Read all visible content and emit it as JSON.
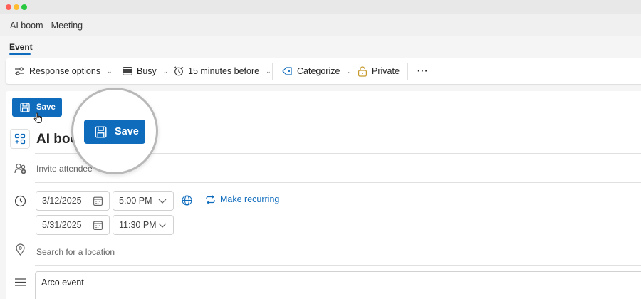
{
  "window": {
    "title": "AI boom - Meeting"
  },
  "tabs": [
    {
      "label": "Event",
      "active": true
    }
  ],
  "toolbar": {
    "response_options": "Response options",
    "show_as": "Busy",
    "reminder": "15 minutes before",
    "categorize": "Categorize",
    "private": "Private",
    "more": "···"
  },
  "form": {
    "save_label": "Save",
    "title": "AI boo",
    "attendees_placeholder": "Invite attendee",
    "start_date": "3/12/2025",
    "start_time": "5:00 PM",
    "end_date": "5/31/2025",
    "end_time": "11:30 PM",
    "make_recurring": "Make recurring",
    "location_placeholder": "Search for a location",
    "body_text": "Arco event"
  },
  "magnifier": {
    "save_label": "Save"
  },
  "colors": {
    "accent": "#0f6cbd",
    "background": "#f5f5f5"
  }
}
